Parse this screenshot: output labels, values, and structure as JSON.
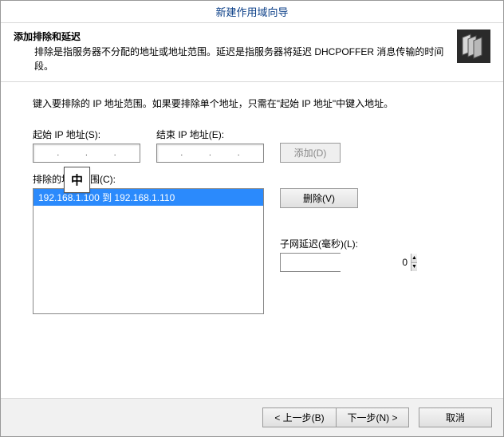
{
  "title": "新建作用域向导",
  "header": {
    "title": "添加排除和延迟",
    "desc": "排除是指服务器不分配的地址或地址范围。延迟是指服务器将延迟 DHCPOFFER 消息传输的时间段。"
  },
  "instruction": "键入要排除的 IP 地址范围。如果要排除单个地址，只需在\"起始 IP 地址\"中键入地址。",
  "labels": {
    "start_ip": "起始 IP 地址(S):",
    "end_ip": "结束 IP 地址(E):",
    "excluded_range": "排除的地址范围(C):",
    "subnet_delay": "子网延迟(毫秒)(L):",
    "add": "添加(D)",
    "remove": "删除(V)",
    "back": "< 上一步(B)",
    "next": "下一步(N) >",
    "cancel": "取消"
  },
  "exclusions": [
    "192.168.1.100 到 192.168.1.110"
  ],
  "delay_value": "0",
  "ime_char": "中"
}
